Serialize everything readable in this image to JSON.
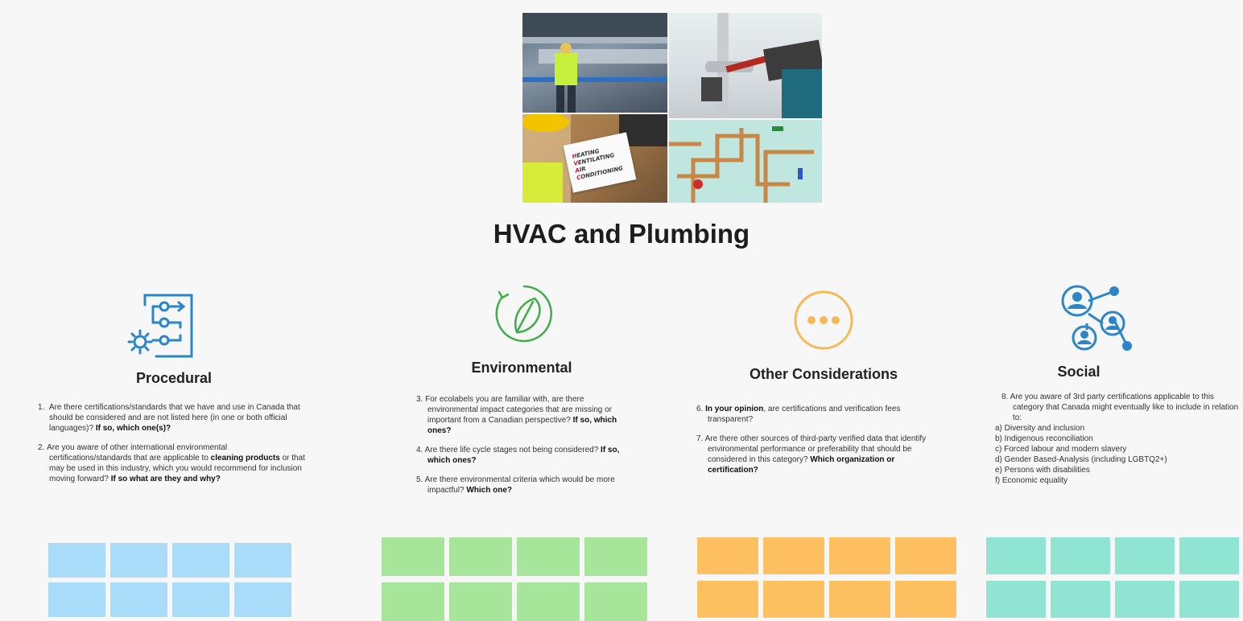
{
  "board": {
    "title": "HVAC and Plumbing",
    "collage_sign": {
      "l1_first": "H",
      "l1_rest": "EATING",
      "l2_first": "V",
      "l2_rest": "ENTILATING",
      "l3_first": "A",
      "l3_rest": "IR",
      "l4_first": "C",
      "l4_rest": "ONDITIONING"
    }
  },
  "colors": {
    "procedural": "#a8dcf8",
    "environmental": "#a7e59a",
    "other": "#ffc062",
    "social": "#8fe4d2",
    "icon_blue": "#2a86c9",
    "icon_green": "#3fae4a",
    "icon_orange": "#f7b955"
  },
  "columns": {
    "procedural": {
      "heading": "Procedural",
      "icon": "process-flow-icon",
      "q1": {
        "num": "1.",
        "text": "Are there certifications/standards that we have and use in Canada that should be considered and are not listed here (in one or both official languages)?",
        "bold": "If so, which one(s)?"
      },
      "q2": {
        "num": "2.",
        "text_a": "Are you aware of other international environmental certifications/standards that are applicable to",
        "bold_a": "cleaning products",
        "text_b": "or that may be used in this industry, which you would recommend for inclusion moving forward?",
        "bold_b": "If so what are they and why?"
      }
    },
    "environmental": {
      "heading": "Environmental",
      "icon": "leaf-cycle-icon",
      "q3": {
        "num": "3.",
        "text": "For ecolabels you are familiar with, are there environmental impact categories that are missing or important from a Canadian perspective?",
        "bold": "If so, which ones?"
      },
      "q4": {
        "num": "4.",
        "text": "Are there life cycle stages not being considered?",
        "bold": "If so, which ones?"
      },
      "q5": {
        "num": "5.",
        "text": "Are there environmental criteria which would be more impactful?",
        "bold": "Which one?"
      }
    },
    "other": {
      "heading": "Other Considerations",
      "icon": "more-dots-icon",
      "q6": {
        "num": "6.",
        "bold": "In your opinion",
        "text": ", are certifications and verification fees transparent?"
      },
      "q7": {
        "num": "7.",
        "text": "Are there other sources of third-party verified data that identify environmental performance or preferability that should be considered in this category?",
        "bold": "Which organization or certification?"
      }
    },
    "social": {
      "heading": "Social",
      "icon": "people-network-icon",
      "q8": {
        "num": "8.",
        "text": "Are you aware of 3rd party certifications applicable to this category that  Canada might eventually like to include in relation to:"
      },
      "items": [
        "a) Diversity and inclusion",
        "b) Indigenous reconciliation",
        "c) Forced labour and modern slavery",
        "d) Gender Based-Analysis (including LGBTQ2+)",
        "e) Persons with disabilities",
        "f) Economic equality"
      ]
    }
  }
}
